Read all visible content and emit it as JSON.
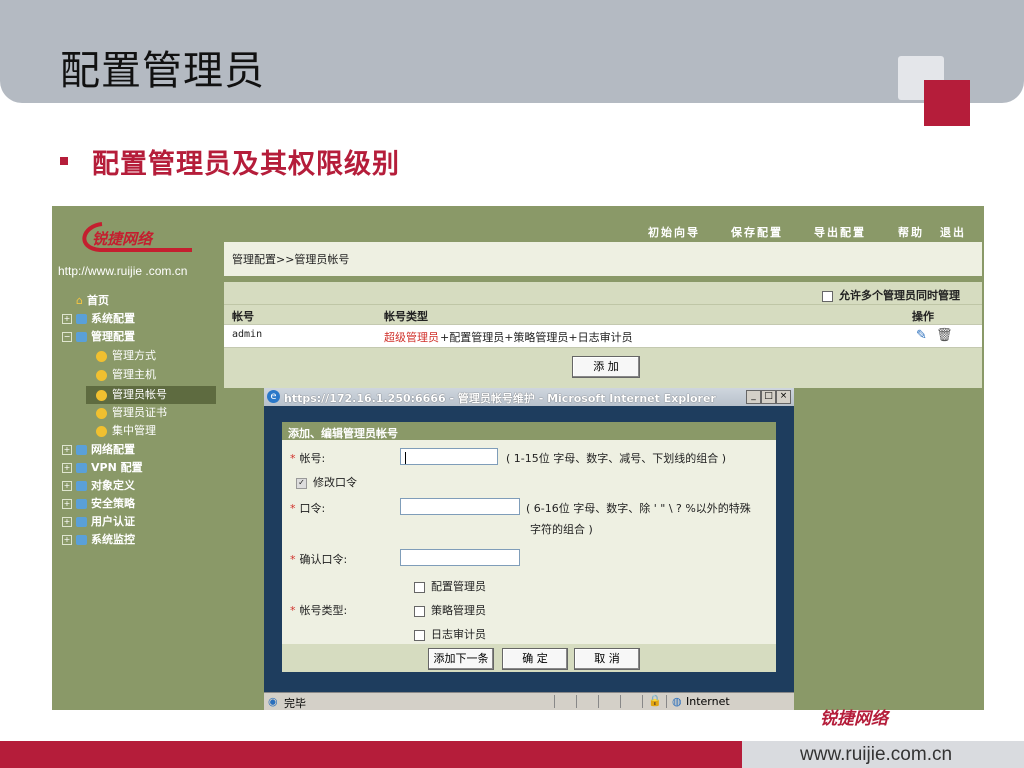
{
  "slide": {
    "title": "配置管理员",
    "bullet": "配置管理员及其权限级别",
    "footer_url": "www.ruijie.com.cn",
    "footer_logo": "锐捷网络"
  },
  "app": {
    "logo_text": "锐捷网络",
    "site_url": "http://www.ruijie .com.cn",
    "top_links": [
      "初始向导",
      "保存配置",
      "导出配置",
      "帮助",
      "退出"
    ],
    "breadcrumb": "管理配置>>管理员帐号"
  },
  "sidebar": {
    "home": "首页",
    "items": [
      {
        "label": "系统配置",
        "sign": "+"
      },
      {
        "label": "管理配置",
        "sign": "−"
      },
      {
        "label": "管理方式"
      },
      {
        "label": "管理主机"
      },
      {
        "label": "管理员帐号"
      },
      {
        "label": "管理员证书"
      },
      {
        "label": "集中管理"
      },
      {
        "label": "网络配置",
        "sign": "+"
      },
      {
        "label": "VPN 配置",
        "sign": "+"
      },
      {
        "label": "对象定义",
        "sign": "+"
      },
      {
        "label": "安全策略",
        "sign": "+"
      },
      {
        "label": "用户认证",
        "sign": "+"
      },
      {
        "label": "系统监控",
        "sign": "+"
      }
    ]
  },
  "table": {
    "allow_multiple": "允许多个管理员同时管理",
    "headers": {
      "account": "帐号",
      "type": "帐号类型",
      "action": "操作"
    },
    "row": {
      "account": "admin",
      "type_super": "超级管理员",
      "type_rest": "+配置管理员+策略管理员+日志审计员"
    },
    "add_button": "添 加"
  },
  "popup": {
    "title": "https://172.16.1.250:6666 - 管理员帐号维护 - Microsoft Internet Explorer",
    "dialog_title": "添加、编辑管理员帐号",
    "account_label": "帐号:",
    "account_hint": "( 1-15位 字母、数字、减号、下划线的组合 )",
    "change_password": "修改口令",
    "password_label": "口令:",
    "password_hint_1": "( 6-16位 字母、数字、除 ' \" \\ ? %以外的特殊",
    "password_hint_2": "字符的组合 )",
    "confirm_label": "确认口令:",
    "type_label": "帐号类型:",
    "types": [
      "配置管理员",
      "策略管理员",
      "日志审计员"
    ],
    "buttons": {
      "add_next": "添加下一条",
      "ok": "确 定",
      "cancel": "取 消"
    },
    "status_done": "完毕",
    "status_zone": "Internet"
  }
}
